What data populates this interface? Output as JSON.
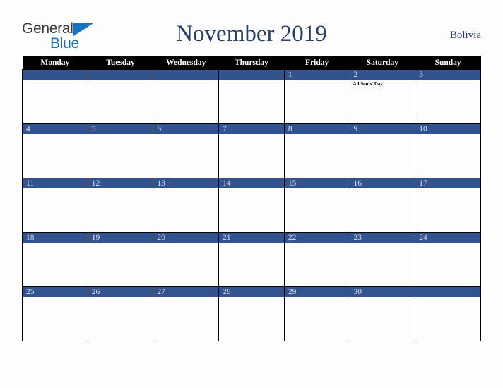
{
  "brand": {
    "name_part1": "General",
    "name_part2": "Blue",
    "triangle_color": "#1574bd",
    "text_color": "#3a3a3a"
  },
  "header": {
    "title": "November 2019",
    "country": "Bolivia",
    "title_color": "#2b3f66"
  },
  "calendar": {
    "weekday_headers": [
      "Monday",
      "Tuesday",
      "Wednesday",
      "Thursday",
      "Friday",
      "Saturday",
      "Sunday"
    ],
    "band_color": "#31538f",
    "header_background": "#000000",
    "weeks": [
      [
        {
          "day": "",
          "holiday": ""
        },
        {
          "day": "",
          "holiday": ""
        },
        {
          "day": "",
          "holiday": ""
        },
        {
          "day": "",
          "holiday": ""
        },
        {
          "day": "1",
          "holiday": ""
        },
        {
          "day": "2",
          "holiday": "All Souls' Day"
        },
        {
          "day": "3",
          "holiday": ""
        }
      ],
      [
        {
          "day": "4",
          "holiday": ""
        },
        {
          "day": "5",
          "holiday": ""
        },
        {
          "day": "6",
          "holiday": ""
        },
        {
          "day": "7",
          "holiday": ""
        },
        {
          "day": "8",
          "holiday": ""
        },
        {
          "day": "9",
          "holiday": ""
        },
        {
          "day": "10",
          "holiday": ""
        }
      ],
      [
        {
          "day": "11",
          "holiday": ""
        },
        {
          "day": "12",
          "holiday": ""
        },
        {
          "day": "13",
          "holiday": ""
        },
        {
          "day": "14",
          "holiday": ""
        },
        {
          "day": "15",
          "holiday": ""
        },
        {
          "day": "16",
          "holiday": ""
        },
        {
          "day": "17",
          "holiday": ""
        }
      ],
      [
        {
          "day": "18",
          "holiday": ""
        },
        {
          "day": "19",
          "holiday": ""
        },
        {
          "day": "20",
          "holiday": ""
        },
        {
          "day": "21",
          "holiday": ""
        },
        {
          "day": "22",
          "holiday": ""
        },
        {
          "day": "23",
          "holiday": ""
        },
        {
          "day": "24",
          "holiday": ""
        }
      ],
      [
        {
          "day": "25",
          "holiday": ""
        },
        {
          "day": "26",
          "holiday": ""
        },
        {
          "day": "27",
          "holiday": ""
        },
        {
          "day": "28",
          "holiday": ""
        },
        {
          "day": "29",
          "holiday": ""
        },
        {
          "day": "30",
          "holiday": ""
        },
        {
          "day": "",
          "holiday": ""
        }
      ]
    ]
  }
}
